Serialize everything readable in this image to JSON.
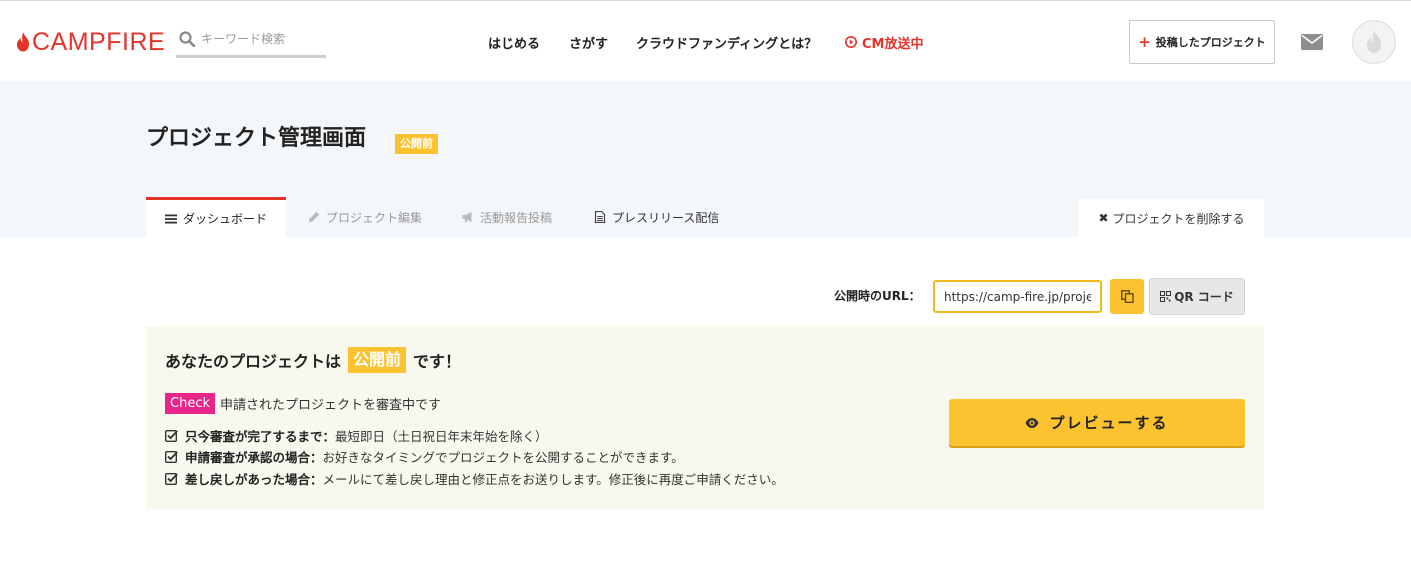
{
  "header": {
    "logo_text": "CAMPFIRE",
    "search_placeholder": "キーワード検索",
    "nav": {
      "start": "はじめる",
      "browse": "さがす",
      "about": "クラウドファンディングとは？",
      "cm": "CM放送中"
    },
    "post_button_label": "投稿したプロジェクト",
    "icons": {
      "search": "search-icon",
      "cm": "play-circle-icon",
      "mail": "envelope-icon",
      "avatar": "flame-icon"
    }
  },
  "page": {
    "title": "プロジェクト管理画面",
    "status_badge": "公開前"
  },
  "tabs": [
    {
      "label": "ダッシュボード",
      "icon": "list-icon",
      "active": true
    },
    {
      "label": "プロジェクト編集",
      "icon": "pencil-icon",
      "active": false
    },
    {
      "label": "活動報告投稿",
      "icon": "megaphone-icon",
      "active": false
    },
    {
      "label": "プレスリリース配信",
      "icon": "document-icon",
      "active": false
    }
  ],
  "delete_tab": {
    "label": "プロジェクトを削除する",
    "icon": "close-icon"
  },
  "url_row": {
    "label": "公開時のURL：",
    "value": "https://camp-fire.jp/projects/",
    "copy_icon": "copy-icon",
    "qr_label": "QR コード",
    "qr_icon": "qr-code-icon"
  },
  "status_card": {
    "heading_prefix": "あなたのプロジェクトは",
    "heading_badge": "公開前",
    "heading_suffix": "です！",
    "check_badge": "Check",
    "check_text": "申請されたプロジェクトを審査中です",
    "items": [
      {
        "label": "只今審査が完了するまで：",
        "text": "最短即日（土日祝日年末年始を除く）"
      },
      {
        "label": "申請審査が承認の場合：",
        "text": "お好きなタイミングでプロジェクトを公開することができます。"
      },
      {
        "label": "差し戻しがあった場合：",
        "text": "メールにて差し戻し理由と修正点をお送りします。修正後に再度ご申請ください。"
      }
    ],
    "preview_button": "プレビューする",
    "preview_icon": "eye-icon"
  },
  "colors": {
    "brand_red": "#e6332a",
    "accent_yellow": "#fcc230",
    "check_pink": "#e8268a",
    "band_bg": "#f4f7fa",
    "card_bg": "#f9f8ee"
  }
}
